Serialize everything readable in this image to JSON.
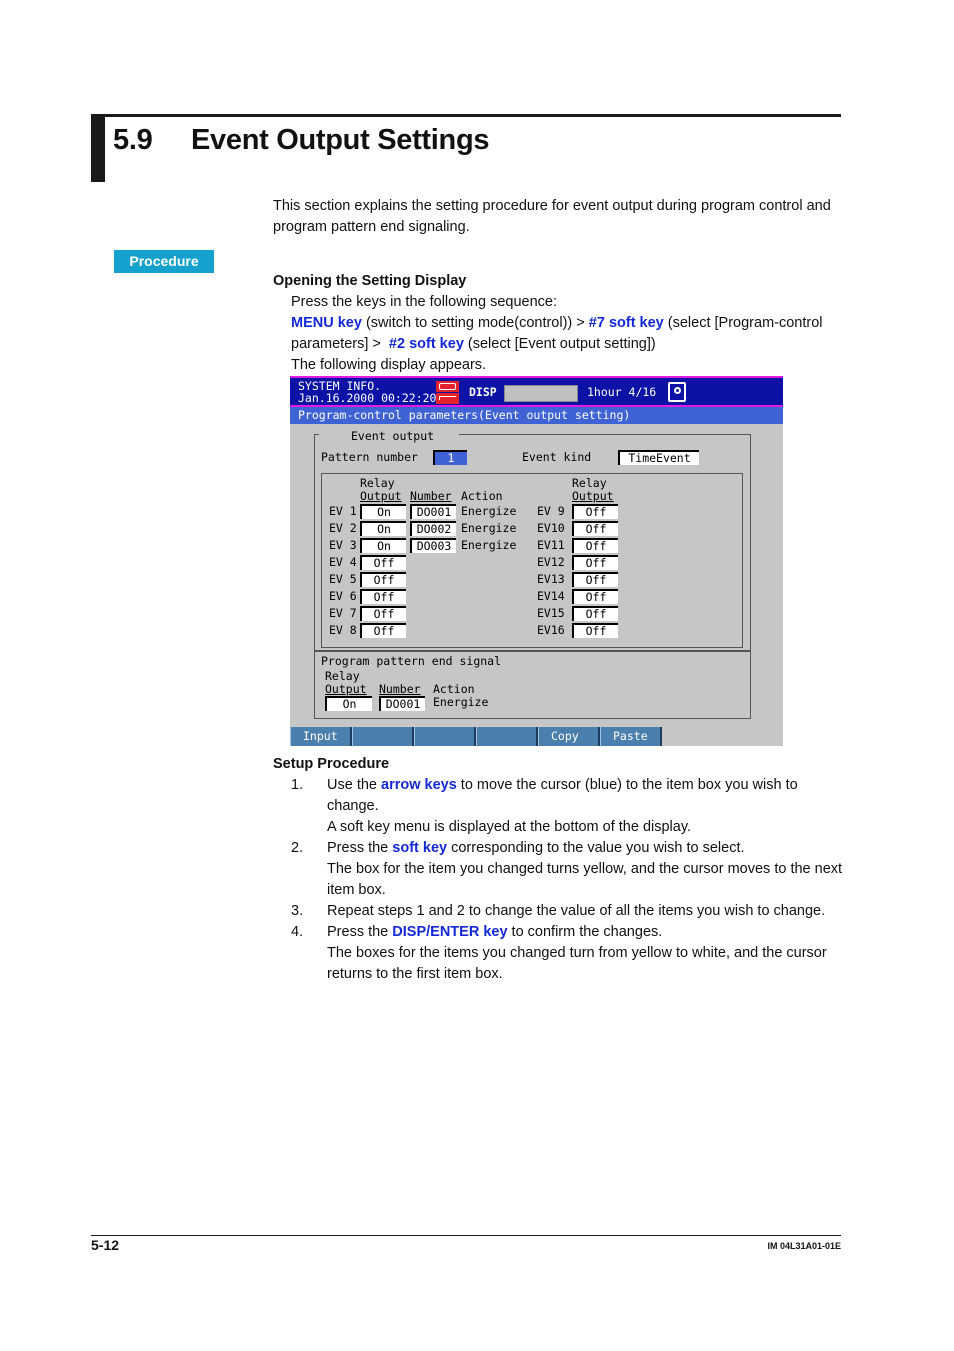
{
  "header": {
    "number": "5.9",
    "title": "Event Output Settings"
  },
  "intro": {
    "line1": "This section explains the setting procedure for event output during program control and",
    "line2": "program pattern end signaling."
  },
  "procedure_badge": "Procedure",
  "opening": {
    "heading": "Opening the Setting Display",
    "line1": "Press the keys in the following sequence:",
    "key1": "MENU key",
    "text1": " (switch to setting mode(control)) > ",
    "key2": "#7 soft key",
    "text2": " (select [Program-control",
    "text3": "parameters] > ",
    "key3": "#2 soft key",
    "text4": " (select [Event output setting])",
    "line_last": "The following display appears."
  },
  "screen": {
    "status": {
      "system_info": "SYSTEM INFO.",
      "datetime": "Jan.16.2000 00:22:20",
      "disp": "DISP",
      "span": "1hour 4/16",
      "icons": [
        "memory-icon",
        "recorder-icon",
        "lock-icon"
      ]
    },
    "subtitle": "Program-control parameters(Event output setting)",
    "event_output": {
      "group_label": "Event output",
      "pattern_label": "Pattern number",
      "pattern_value": "1",
      "kind_label": "Event kind",
      "kind_value": "TimeEvent",
      "col_relay1": "Relay",
      "col_relay2": "Output",
      "col_number": "Number",
      "col_action": "Action",
      "left": [
        {
          "ev": "EV 1",
          "relay": "On",
          "number": "DO001",
          "action": "Energize"
        },
        {
          "ev": "EV 2",
          "relay": "On",
          "number": "DO002",
          "action": "Energize"
        },
        {
          "ev": "EV 3",
          "relay": "On",
          "number": "DO003",
          "action": "Energize"
        },
        {
          "ev": "EV 4",
          "relay": "Off"
        },
        {
          "ev": "EV 5",
          "relay": "Off"
        },
        {
          "ev": "EV 6",
          "relay": "Off"
        },
        {
          "ev": "EV 7",
          "relay": "Off"
        },
        {
          "ev": "EV 8",
          "relay": "Off"
        }
      ],
      "right": [
        {
          "ev": "EV 9",
          "relay": "Off"
        },
        {
          "ev": "EV10",
          "relay": "Off"
        },
        {
          "ev": "EV11",
          "relay": "Off"
        },
        {
          "ev": "EV12",
          "relay": "Off"
        },
        {
          "ev": "EV13",
          "relay": "Off"
        },
        {
          "ev": "EV14",
          "relay": "Off"
        },
        {
          "ev": "EV15",
          "relay": "Off"
        },
        {
          "ev": "EV16",
          "relay": "Off"
        }
      ]
    },
    "end_signal": {
      "label": "Program pattern end signal",
      "relay1": "Relay",
      "relay2": "Output",
      "number_label": "Number",
      "action_label": "Action",
      "relay_value": "On",
      "number_value": "DO001",
      "action_value": "Energize"
    },
    "softkeys": [
      "Input",
      "",
      "",
      "",
      "Copy",
      "Paste"
    ]
  },
  "setup": {
    "heading": "Setup Procedure",
    "steps": [
      {
        "num": "1.",
        "pre": "Use the ",
        "key": "arrow keys",
        "post": " to move the cursor (blue) to the item box you wish to",
        "cont": "change.",
        "note1": "A soft key menu is displayed at the bottom of the display."
      },
      {
        "num": "2.",
        "pre": "Press the ",
        "key": "soft key",
        "post": " corresponding to the value you wish to select.",
        "note1": "The box for the item you changed turns yellow, and the cursor moves to the next",
        "note2": "item box."
      },
      {
        "num": "3.",
        "text": "Repeat steps 1 and 2 to change the value of all the items you wish to change."
      },
      {
        "num": "4.",
        "pre": "Press the ",
        "key": "DISP/ENTER key",
        "post": " to confirm the changes.",
        "note1": "The boxes for the items you changed turn from yellow to white, and the cursor",
        "note2": "returns to the first item box."
      }
    ]
  },
  "footer": {
    "page": "5-12",
    "doc_id": "IM 04L31A01-01E"
  }
}
